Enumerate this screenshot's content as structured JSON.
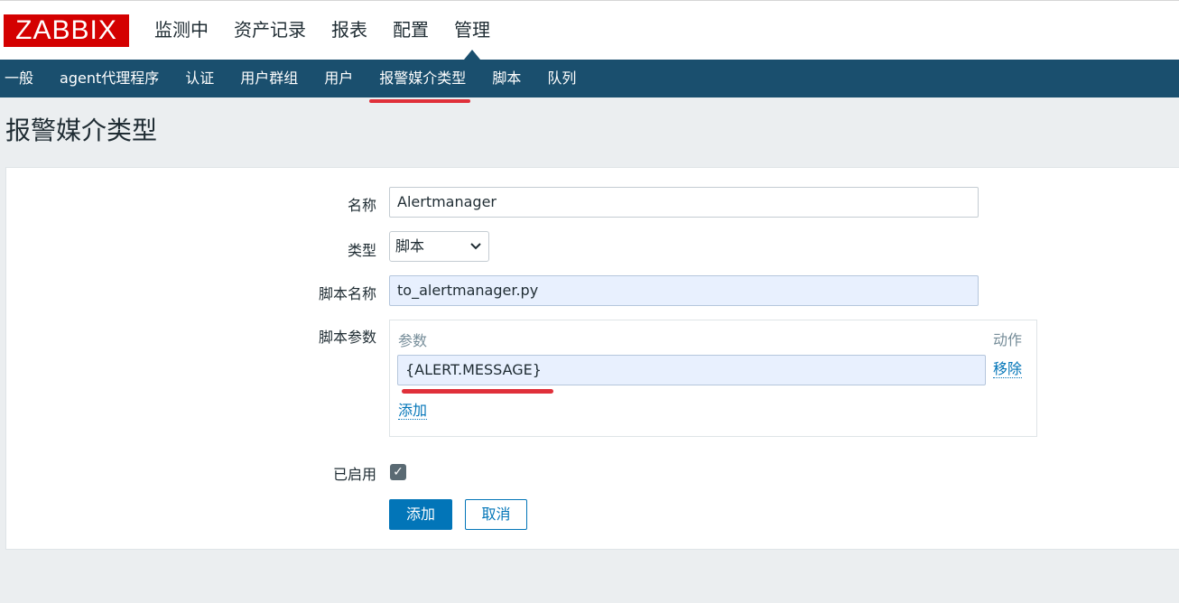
{
  "logo": "ZABBIX",
  "main_nav": [
    {
      "label": "监测中"
    },
    {
      "label": "资产记录"
    },
    {
      "label": "报表"
    },
    {
      "label": "配置"
    },
    {
      "label": "管理"
    }
  ],
  "sub_nav": [
    {
      "label": "一般"
    },
    {
      "label": "agent代理程序"
    },
    {
      "label": "认证"
    },
    {
      "label": "用户群组"
    },
    {
      "label": "用户"
    },
    {
      "label": "报警媒介类型"
    },
    {
      "label": "脚本"
    },
    {
      "label": "队列"
    }
  ],
  "page_title": "报警媒介类型",
  "form": {
    "name_label": "名称",
    "name_value": "Alertmanager",
    "type_label": "类型",
    "type_value": "脚本",
    "script_name_label": "脚本名称",
    "script_name_value": "to_alertmanager.py",
    "script_params_label": "脚本参数",
    "params_header": "参数",
    "action_header": "动作",
    "param_value": "{ALERT.MESSAGE}",
    "remove_link": "移除",
    "add_link": "添加",
    "enabled_label": "已启用",
    "enabled_checked": true,
    "submit_button": "添加",
    "cancel_button": "取消"
  },
  "colors": {
    "logo_bg": "#d40000",
    "subnav_bg": "#1a4f6e",
    "highlight_red": "#e0303a",
    "primary_blue": "#0275b8"
  }
}
